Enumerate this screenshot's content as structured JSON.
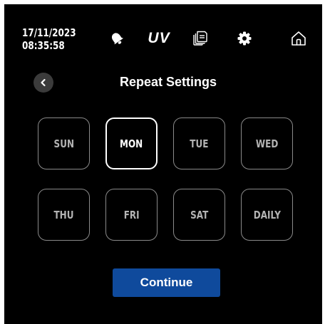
{
  "status": {
    "date": "17/11/2023",
    "time": "08:35:58"
  },
  "toolbar": {
    "icons": [
      "bell-icon",
      "uv-icon",
      "document-icon",
      "gear-icon",
      "home-icon"
    ],
    "uv_label": "UV"
  },
  "header": {
    "back_icon": "chevron-left-icon",
    "title": "Repeat Settings"
  },
  "days": [
    {
      "label": "SUN",
      "selected": false
    },
    {
      "label": "MON",
      "selected": true
    },
    {
      "label": "TUE",
      "selected": false
    },
    {
      "label": "WED",
      "selected": false
    },
    {
      "label": "THU",
      "selected": false
    },
    {
      "label": "FRI",
      "selected": false
    },
    {
      "label": "SAT",
      "selected": false
    },
    {
      "label": "DAILY",
      "selected": false
    }
  ],
  "actions": {
    "continue_label": "Continue"
  },
  "colors": {
    "background": "#000000",
    "button_border": "#8a8a8a",
    "selected_border": "#ffffff",
    "continue_bg": "#0f4a9c",
    "back_button_bg": "#3b3b3b"
  }
}
